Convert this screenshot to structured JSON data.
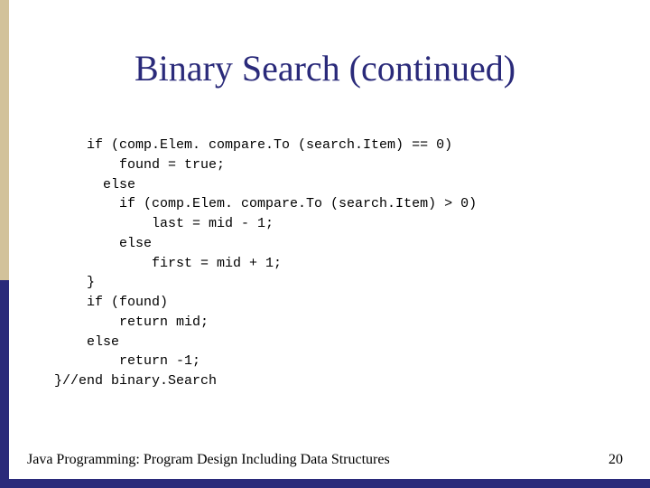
{
  "slide": {
    "title": "Binary Search (continued)",
    "code": "    if (comp.Elem. compare.To (search.Item) == 0)\n        found = true;\n      else\n        if (comp.Elem. compare.To (search.Item) > 0)\n            last = mid - 1;\n        else\n            first = mid + 1;\n    }\n    if (found)\n        return mid;\n    else\n        return -1;\n}//end binary.Search",
    "footer_left": "Java Programming: Program Design Including Data Structures",
    "page_number": "20"
  },
  "colors": {
    "title": "#2a2a7a",
    "accent_blue": "#2a2a7a",
    "accent_tan": "#d2c29a"
  }
}
